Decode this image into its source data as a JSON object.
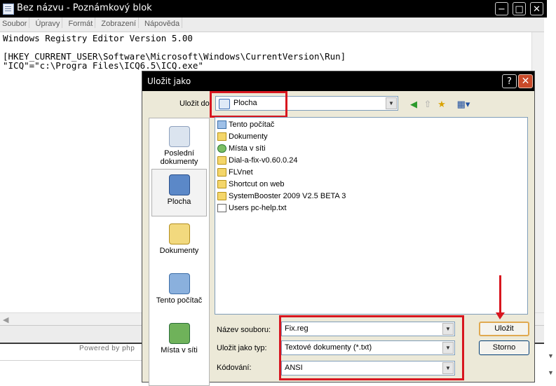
{
  "notepad": {
    "title": "Bez názvu - Poznámkový blok",
    "menu": [
      "Soubor",
      "Úpravy",
      "Formát",
      "Zobrazení",
      "Nápověda"
    ],
    "lines": [
      "Windows Registry Editor Version 5.00",
      "",
      "[HKEY_CURRENT_USER\\Software\\Microsoft\\Windows\\CurrentVersion\\Run]",
      "\"ICQ\"=\"c:\\Progra Files\\ICQ6.5\\ICQ.exe\""
    ],
    "caption_buttons": {
      "minimize": "−",
      "maximize": "□",
      "close": "✕"
    }
  },
  "footer": {
    "powered": "Powered by php"
  },
  "dialog": {
    "title": "Uložit jako",
    "help": "?",
    "close": "✕",
    "save_in_label": "Uložit do",
    "save_in_value": "Plocha",
    "places": [
      "Poslední dokumenty",
      "Plocha",
      "Dokumenty",
      "Tento počítač",
      "Místa v síti"
    ],
    "files": [
      {
        "name": "Tento počítač",
        "icon": "computer-icon"
      },
      {
        "name": "Dokumenty",
        "icon": "documents-folder-icon"
      },
      {
        "name": "Místa v síti",
        "icon": "network-icon"
      },
      {
        "name": "Dial-a-fix-v0.60.0.24",
        "icon": "folder-icon"
      },
      {
        "name": "FLVnet",
        "icon": "folder-icon"
      },
      {
        "name": "Shortcut on web",
        "icon": "folder-icon"
      },
      {
        "name": "SystemBooster 2009 V2.5 BETA 3",
        "icon": "folder-icon"
      },
      {
        "name": "Users pc-help.txt",
        "icon": "text-file-icon"
      }
    ],
    "filename_label": "Název souboru:",
    "filename_value": "Fix.reg",
    "filetype_label": "Uložit jako typ:",
    "filetype_value": "Textové dokumenty (*.txt)",
    "encoding_label": "Kódování:",
    "encoding_value": "ANSI",
    "save_button": "Uložit",
    "cancel_button": "Storno"
  },
  "colors": {
    "highlight": "#d8161f",
    "dialog_bg": "#ece9d8",
    "titlebar": "#000000"
  }
}
